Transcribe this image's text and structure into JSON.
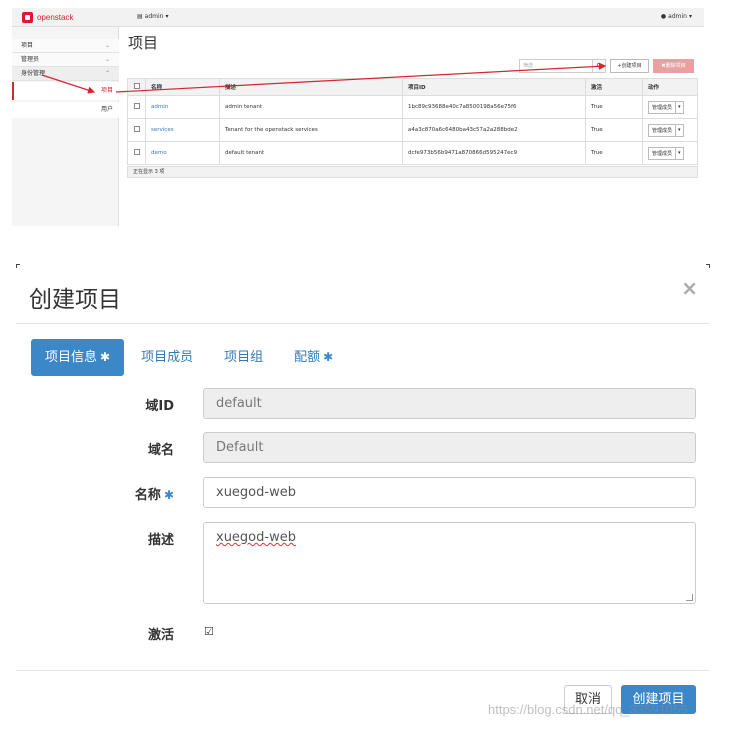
{
  "top": {
    "brand": "openstack",
    "project_menu": "admin",
    "user_menu": "admin",
    "sidebar": {
      "items": [
        {
          "label": "项目"
        },
        {
          "label": "管理员"
        },
        {
          "label": "身份管理"
        }
      ],
      "subitems": [
        {
          "label": "项目"
        },
        {
          "label": "用户"
        }
      ]
    },
    "page_title": "项目",
    "filter_placeholder": "筛选",
    "create_label": "创建项目",
    "delete_label": "删除项目",
    "table": {
      "headers": [
        "名称",
        "描述",
        "项目ID",
        "激活",
        "动作"
      ],
      "rows": [
        {
          "name": "admin",
          "description": "admin tenant",
          "id": "1bc89c93688e40c7a8500198a56e75f6",
          "enabled": "True",
          "action": "管理成员"
        },
        {
          "name": "services",
          "description": "Tenant for the openstack services",
          "id": "a4a3c870a6c6480ba43c57a2a288bde2",
          "enabled": "True",
          "action": "管理成员"
        },
        {
          "name": "demo",
          "description": "default tenant",
          "id": "dcfe973b56b9471a870866d595247ec9",
          "enabled": "True",
          "action": "管理成员"
        }
      ],
      "footer": "正在显示 3 项"
    }
  },
  "modal": {
    "title": "创建项目",
    "close": "×",
    "tabs": [
      {
        "label": "项目信息",
        "required": "✱"
      },
      {
        "label": "项目成员",
        "required": ""
      },
      {
        "label": "项目组",
        "required": ""
      },
      {
        "label": "配额",
        "required": "✱"
      }
    ],
    "fields": {
      "domain_id": {
        "label": "域ID",
        "value": "default"
      },
      "domain_name": {
        "label": "域名",
        "value": "Default"
      },
      "name": {
        "label": "名称",
        "required": "✱",
        "value": "xuegod-web"
      },
      "description": {
        "label": "描述",
        "value": "xuegod-web"
      },
      "enabled": {
        "label": "激活",
        "checked": "☑"
      }
    },
    "cancel_label": "取消",
    "submit_label": "创建项目"
  },
  "watermark": "https://blog.csdn.net/qq_33591055",
  "colors": {
    "brand_red": "#d8252f",
    "primary_blue": "#3c87c8",
    "link_blue": "#337ab7"
  }
}
